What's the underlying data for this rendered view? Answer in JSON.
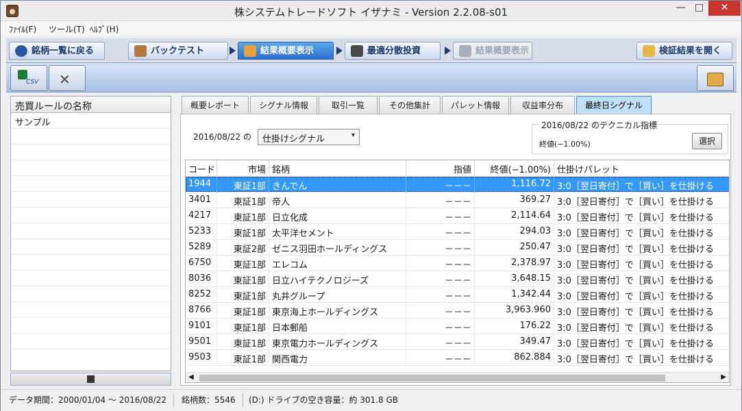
{
  "window": {
    "title": "株システムトレードソフト イザナミ - Version 2.2.08-s01",
    "min_label": "—",
    "max_label": "□",
    "close_label": "✕"
  },
  "menu": [
    "ﾌｧｲﾙ(F)",
    "ツール(T)",
    "ﾍﾙﾌﾟ(H)"
  ],
  "toolbar_tabs": [
    {
      "label": "銘柄一覧に戻る",
      "icon": "eye-icon"
    },
    {
      "label": "バックテスト",
      "icon": "bag-icon"
    },
    {
      "label": "結果概要表示",
      "icon": "chart-icon"
    },
    {
      "label": "最適分散投資",
      "icon": "calculator-icon"
    },
    {
      "label": "結果概要表示",
      "icon": "chart-icon"
    },
    {
      "label": "検証結果を開く",
      "icon": "open-icon"
    }
  ],
  "tools": {
    "csv": "CSV"
  },
  "left": {
    "header": "売買ルールの名称",
    "items": [
      "サンプル"
    ],
    "save_icon": "floppy-icon"
  },
  "tabs": [
    "概要レポート",
    "シグナル情報",
    "取引一覧",
    "その他集計",
    "パレット情報",
    "収益率分布",
    "最終日シグナル"
  ],
  "filter": {
    "date_label": "2016/08/22 の",
    "select_value": "仕掛けシグナル",
    "tech_title": "2016/08/22 のテクニカル指標",
    "tech_value": "終値(−1.00%)",
    "select_button": "選択"
  },
  "grid": {
    "columns": [
      "コード",
      "市場",
      "銘柄",
      "指値",
      "終値(−1.00%)",
      "仕掛けパレット"
    ],
    "rows": [
      [
        "1944",
        "東証1部",
        "きんでん",
        "－－－",
        "1,116.72",
        "3:0［翌日寄付］で［買い］を仕掛ける"
      ],
      [
        "3401",
        "東証1部",
        "帝人",
        "－－－",
        "369.27",
        "3:0［翌日寄付］で［買い］を仕掛ける"
      ],
      [
        "4217",
        "東証1部",
        "日立化成",
        "－－－",
        "2,114.64",
        "3:0［翌日寄付］で［買い］を仕掛ける"
      ],
      [
        "5233",
        "東証1部",
        "太平洋セメント",
        "－－－",
        "294.03",
        "3:0［翌日寄付］で［買い］を仕掛ける"
      ],
      [
        "5289",
        "東証2部",
        "ゼニス羽田ホールディングス",
        "－－－",
        "250.47",
        "3:0［翌日寄付］で［買い］を仕掛ける"
      ],
      [
        "6750",
        "東証1部",
        "エレコム",
        "－－－",
        "2,378.97",
        "3:0［翌日寄付］で［買い］を仕掛ける"
      ],
      [
        "8036",
        "東証1部",
        "日立ハイテクノロジーズ",
        "－－－",
        "3,648.15",
        "3:0［翌日寄付］で［買い］を仕掛ける"
      ],
      [
        "8252",
        "東証1部",
        "丸井グループ",
        "－－－",
        "1,342.44",
        "3:0［翌日寄付］で［買い］を仕掛ける"
      ],
      [
        "8766",
        "東証1部",
        "東京海上ホールディングス",
        "－－－",
        "3,963.960",
        "3:0［翌日寄付］で［買い］を仕掛ける"
      ],
      [
        "9101",
        "東証1部",
        "日本郵船",
        "－－－",
        "176.22",
        "3:0［翌日寄付］で［買い］を仕掛ける"
      ],
      [
        "9501",
        "東証1部",
        "東京電力ホールディングス",
        "－－－",
        "349.47",
        "3:0［翌日寄付］で［買い］を仕掛ける"
      ],
      [
        "9503",
        "東証1部",
        "関西電力",
        "－－－",
        "862.884",
        "3:0［翌日寄付］で［買い］を仕掛ける"
      ]
    ]
  },
  "status": {
    "period": "データ期間：2000/01/04 〜 2016/08/22",
    "count": "銘柄数：5546",
    "disk": "(D:) ドライブの空き容量：約 301.8 GB"
  }
}
